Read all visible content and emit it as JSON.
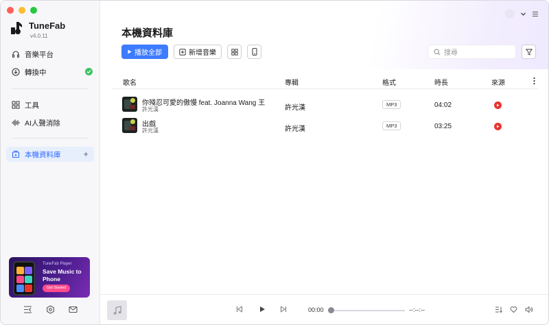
{
  "app": {
    "name": "TuneFab",
    "version": "v4.0.11"
  },
  "sidebar": {
    "items": [
      {
        "label": "音樂平台"
      },
      {
        "label": "轉換中"
      },
      {
        "label": "工具"
      },
      {
        "label": "AI人聲消除"
      },
      {
        "label": "本機資料庫"
      }
    ],
    "promo": {
      "small": "TuneFab Player",
      "title": "Save Music to Phone",
      "button": "Get Started"
    }
  },
  "main": {
    "title": "本機資料庫",
    "play_all": "播放全部",
    "add_music": "新增音樂",
    "search_placeholder": "搜尋"
  },
  "table": {
    "headers": {
      "title": "歌名",
      "album": "專輯",
      "format": "格式",
      "duration": "時長",
      "source": "來源"
    },
    "rows": [
      {
        "title": "你殘忍可愛的傲慢 feat. Joanna Wang 王...",
        "artist": "許光漢",
        "album": "許光漢",
        "format": "MP3",
        "duration": "04:02"
      },
      {
        "title": "出戲",
        "artist": "許光漢",
        "album": "許光漢",
        "format": "MP3",
        "duration": "03:25"
      }
    ]
  },
  "player": {
    "current_time": "00:00",
    "total_time": "--:--:--",
    "progress": 0
  },
  "colors": {
    "accent": "#3d7bff",
    "success": "#3cc462",
    "source_red": "#e8362f"
  }
}
